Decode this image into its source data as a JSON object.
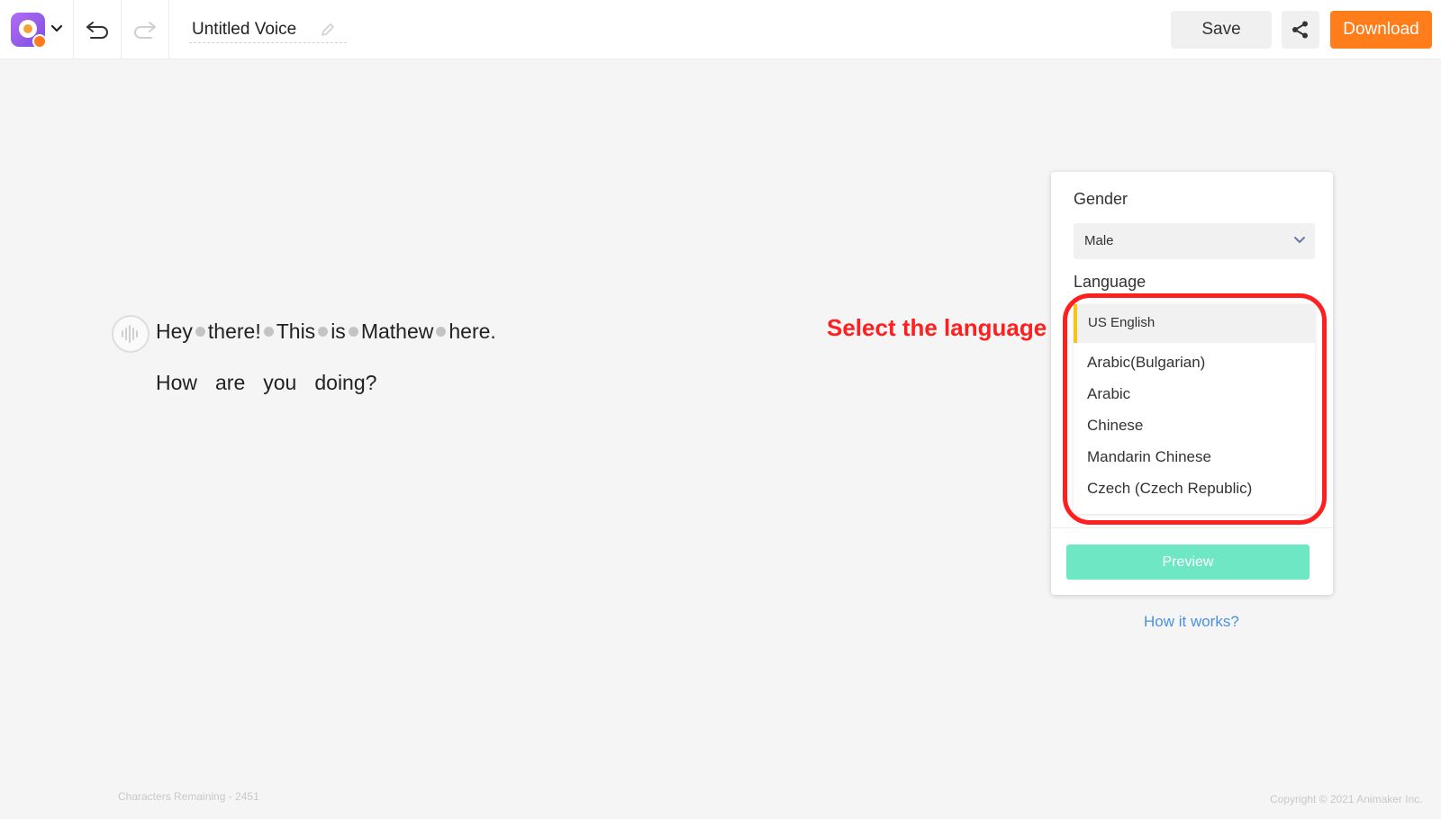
{
  "header": {
    "title": "Untitled Voice",
    "save_label": "Save",
    "download_label": "Download",
    "icons": {
      "logo": "animaker-voice-logo",
      "menu": "chevron-down-icon",
      "undo": "undo-icon",
      "redo": "redo-icon",
      "edit": "pencil-icon",
      "share": "share-icon"
    }
  },
  "editor": {
    "line1": [
      "Hey",
      "there!",
      "This",
      "is",
      "Mathew",
      "here."
    ],
    "line2": [
      "How",
      "are",
      "you",
      "doing?"
    ]
  },
  "annotation": {
    "text": "Select the language",
    "color": "#ff1f1f"
  },
  "panel": {
    "gender_label": "Gender",
    "gender_value": "Male",
    "language_label": "Language",
    "languages": {
      "selected": "US English",
      "options": [
        "Arabic(Bulgarian)",
        "Arabic",
        "Chinese",
        "Mandarin Chinese",
        "Czech (Czech Republic)"
      ]
    },
    "preview_label": "Preview"
  },
  "help_link": "How it works?",
  "footer": {
    "chars_remaining": "Characters Remaining - 2451",
    "copyright": "Copyright © 2021 Animaker Inc."
  },
  "colors": {
    "accent_orange": "#ff7d1a",
    "preview_green": "#6ee8c4",
    "selected_marker": "#f5c518",
    "link_blue": "#4a90e2"
  }
}
